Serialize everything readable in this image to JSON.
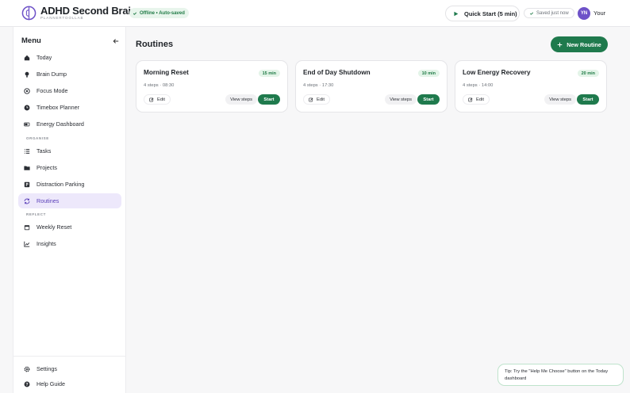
{
  "header": {
    "app_title": "ADHD Second Brain",
    "app_subtitle": "PLANNERTOOLLAB",
    "offline_status": "Offline • Auto-saved",
    "quick_start_label": "Quick Start (5 min)",
    "saved_status": "Saved just now",
    "avatar_initials": "YN",
    "user_name": "Your"
  },
  "sidebar": {
    "title": "Menu",
    "items": [
      {
        "label": "Today",
        "icon": "home-icon"
      },
      {
        "label": "Brain Dump",
        "icon": "lightbulb-icon"
      },
      {
        "label": "Focus Mode",
        "icon": "target-icon"
      },
      {
        "label": "Timebox Planner",
        "icon": "clock-icon"
      },
      {
        "label": "Energy Dashboard",
        "icon": "battery-icon"
      }
    ],
    "organise_label": "ORGANISE",
    "organise_items": [
      {
        "label": "Tasks",
        "icon": "list-icon"
      },
      {
        "label": "Projects",
        "icon": "folder-icon"
      },
      {
        "label": "Distraction Parking",
        "icon": "parking-icon"
      },
      {
        "label": "Routines",
        "icon": "repeat-icon",
        "active": true
      }
    ],
    "reflect_label": "REFLECT",
    "reflect_items": [
      {
        "label": "Weekly Reset",
        "icon": "calendar-icon"
      },
      {
        "label": "Insights",
        "icon": "chart-icon"
      }
    ],
    "bottom_items": [
      {
        "label": "Settings",
        "icon": "gear-icon"
      },
      {
        "label": "Help Guide",
        "icon": "help-icon"
      }
    ]
  },
  "main": {
    "title": "Routines",
    "new_button_label": "New Routine",
    "routines": [
      {
        "name": "Morning Reset",
        "duration": "15 min",
        "meta": "4 steps · 08:30",
        "edit": "Edit",
        "view": "View steps",
        "start": "Start"
      },
      {
        "name": "End of Day Shutdown",
        "duration": "10 min",
        "meta": "4 steps · 17:30",
        "edit": "Edit",
        "view": "View steps",
        "start": "Start"
      },
      {
        "name": "Low Energy Recovery",
        "duration": "20 min",
        "meta": "4 steps · 14:00",
        "edit": "Edit",
        "view": "View steps",
        "start": "Start"
      }
    ]
  },
  "tip": "Tip: Try the \"Help Me Choose\" button on the Today dashboard",
  "colors": {
    "accent_green": "#1f7a4d",
    "accent_purple": "#6e52c8",
    "active_bg": "#ede8fb"
  }
}
